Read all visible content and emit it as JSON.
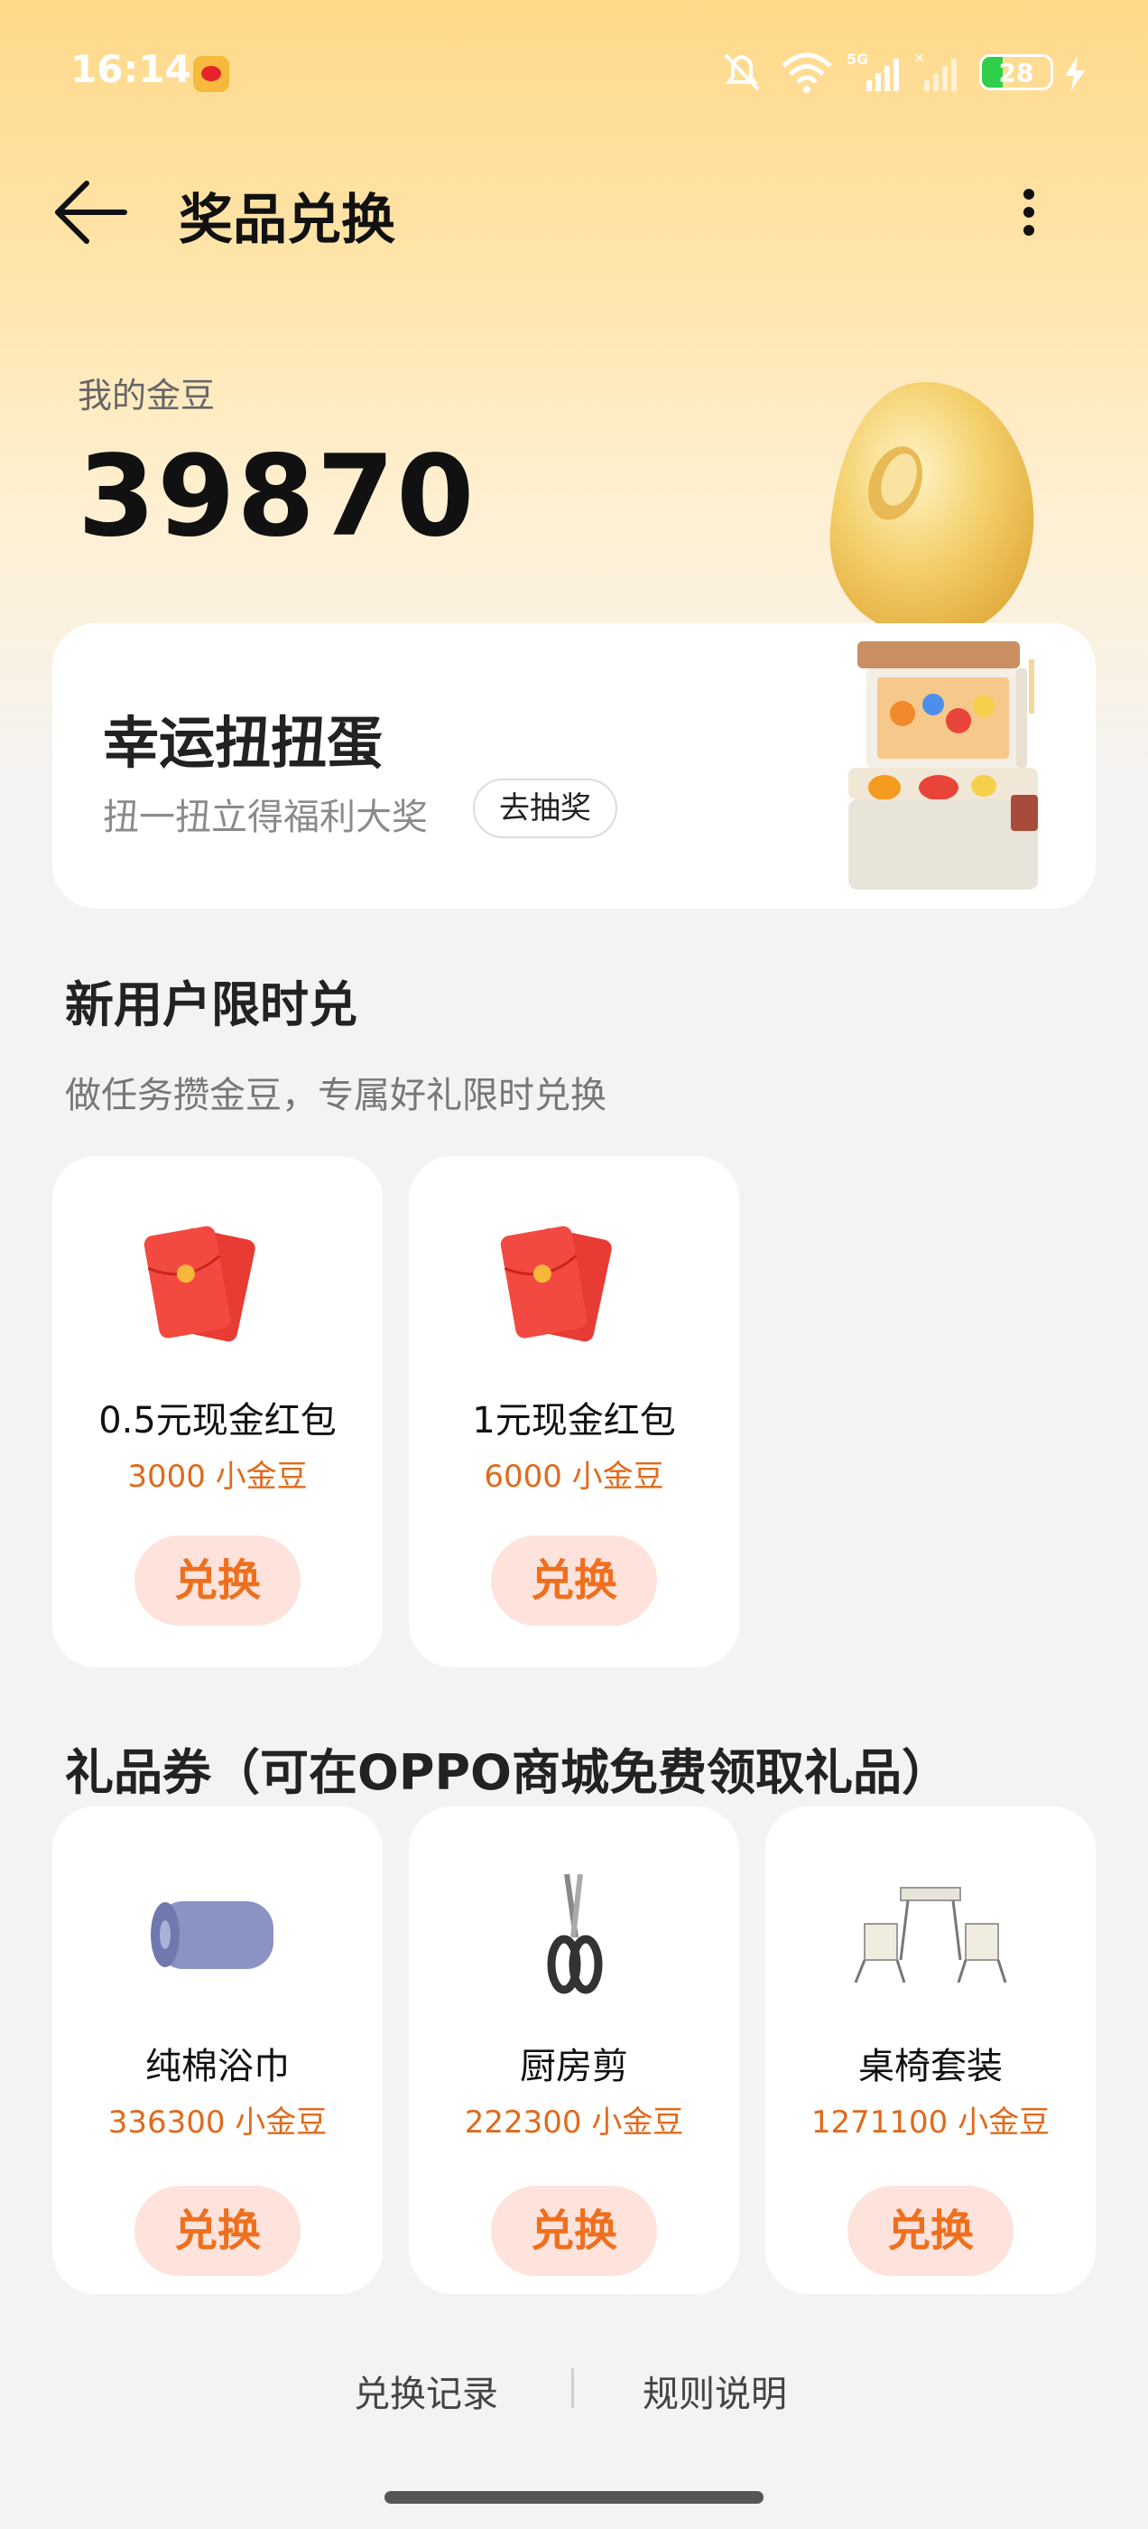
{
  "status_bar": {
    "time": "16:14",
    "battery": "28"
  },
  "header": {
    "title": "奖品兑换"
  },
  "balance": {
    "label": "我的金豆",
    "value": "39870"
  },
  "lucky": {
    "title": "幸运扭扭蛋",
    "subtitle": "扭一扭立得福利大奖",
    "button": "去抽奖"
  },
  "new_user": {
    "title": "新用户限时兑",
    "subtitle": "做任务攒金豆，专属好礼限时兑换",
    "items": [
      {
        "name": "0.5元现金红包",
        "cost": "3000 小金豆",
        "button": "兑换",
        "icon": "red-envelope-icon"
      },
      {
        "name": "1元现金红包",
        "cost": "6000 小金豆",
        "button": "兑换",
        "icon": "red-envelope-icon"
      }
    ]
  },
  "gifts": {
    "title": "礼品券（可在OPPO商城免费领取礼品）",
    "items": [
      {
        "name": "纯棉浴巾",
        "cost": "336300 小金豆",
        "button": "兑换",
        "icon": "towel-icon"
      },
      {
        "name": "厨房剪",
        "cost": "222300 小金豆",
        "button": "兑换",
        "icon": "scissors-icon"
      },
      {
        "name": "桌椅套装",
        "cost": "1271100 小金豆",
        "button": "兑换",
        "icon": "table-chairs-icon"
      }
    ]
  },
  "footer": {
    "records": "兑换记录",
    "rules": "规则说明"
  },
  "colors": {
    "accent": "#ef6f1e",
    "button_bg": "#fde3db",
    "header_gradient_top": "#ffd98a"
  }
}
